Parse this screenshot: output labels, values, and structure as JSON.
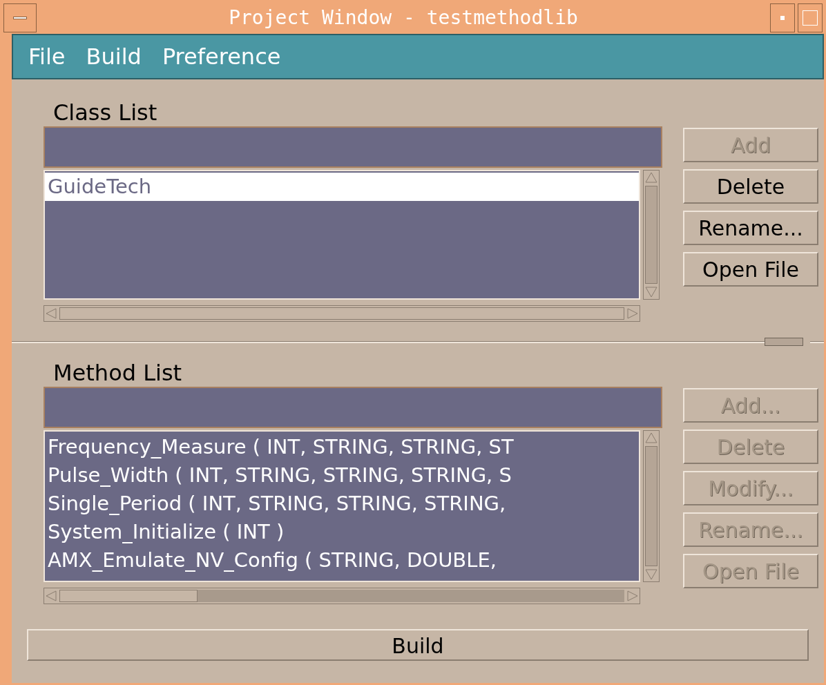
{
  "window": {
    "title": "Project Window - testmethodlib"
  },
  "menu": [
    "File",
    "Build",
    "Preference"
  ],
  "class_list": {
    "label": "Class List",
    "items": [
      {
        "text": "GuideTech",
        "selected": true
      }
    ],
    "buttons": [
      {
        "label": "Add",
        "disabled": true
      },
      {
        "label": "Delete",
        "disabled": false
      },
      {
        "label": "Rename...",
        "disabled": false
      },
      {
        "label": "Open File",
        "disabled": false
      }
    ]
  },
  "method_list": {
    "label": "Method List",
    "items": [
      {
        "text": "Frequency_Measure ( INT,  STRING,  STRING,  ST",
        "selected": false
      },
      {
        "text": "Pulse_Width ( INT,  STRING,  STRING,  STRING,  S",
        "selected": false
      },
      {
        "text": "Single_Period ( INT,  STRING,  STRING,  STRING,",
        "selected": false
      },
      {
        "text": "System_Initialize ( INT )",
        "selected": false
      },
      {
        "text": "AMX_Emulate_NV_Config ( STRING,  DOUBLE,",
        "selected": false
      }
    ],
    "buttons": [
      {
        "label": "Add...",
        "disabled": true
      },
      {
        "label": "Delete",
        "disabled": true
      },
      {
        "label": "Modify...",
        "disabled": true
      },
      {
        "label": "Rename...",
        "disabled": true
      },
      {
        "label": "Open File",
        "disabled": true
      }
    ]
  },
  "build_button": {
    "label": "Build"
  }
}
